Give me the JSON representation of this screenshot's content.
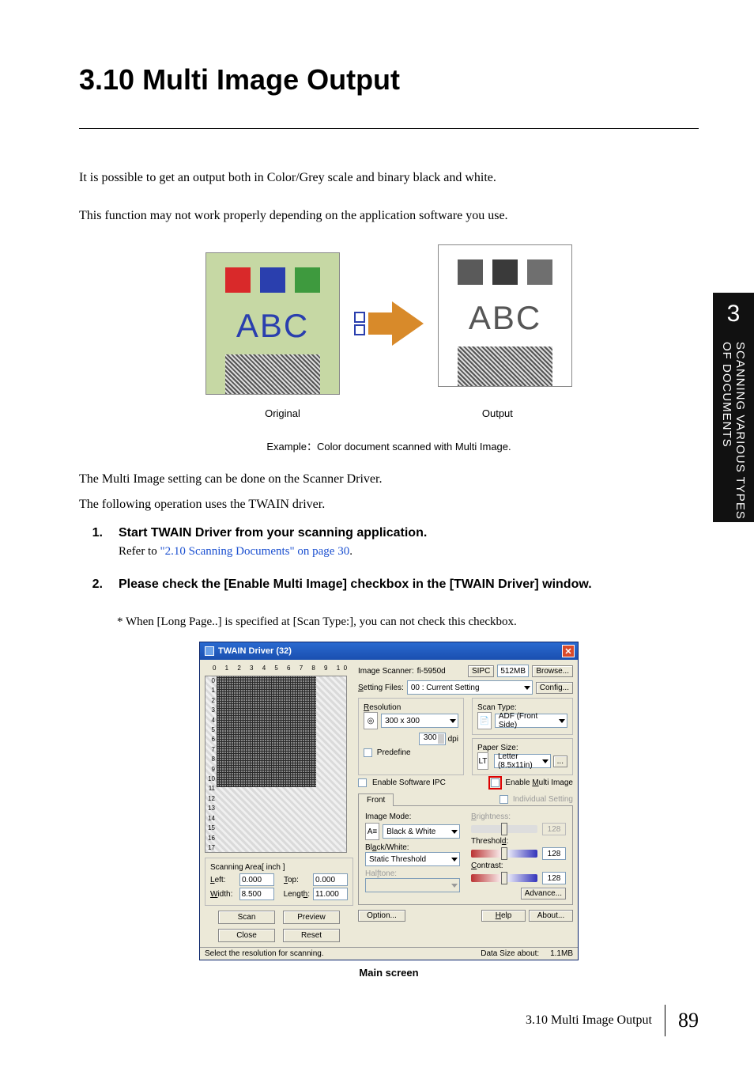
{
  "title": "3.10 Multi Image Output",
  "intro1": "It is possible to get an output  both in Color/Grey scale and binary black and white.",
  "intro2": "This function may not work properly depending on the application software you use.",
  "diagram": {
    "abc": "ABC",
    "original": "Original",
    "output": "Output"
  },
  "example_prefix": "Example",
  "example_colon": "：",
  "example_text": "Color document scanned with Multi Image.",
  "para1": "The Multi Image setting can be done on the Scanner Driver.",
  "para2": "The following operation uses the TWAIN driver.",
  "steps": {
    "s1": {
      "num": "1.",
      "title": "Start TWAIN Driver from your scanning application.",
      "refer": "Refer to ",
      "link": "\"2.10 Scanning Documents\" on page 30",
      "dot": "."
    },
    "s2": {
      "num": "2.",
      "title": "Please check the [Enable Multi Image] checkbox in the [TWAIN Driver] window.",
      "note": "* When [Long Page..] is specified at [Scan Type:], you can not check this checkbox."
    }
  },
  "dlg": {
    "title": "TWAIN Driver (32)",
    "ruler_h": "0   1   2   3   4   5   6   7   8   9  10  11",
    "ruler_v": [
      "0",
      "1",
      "2",
      "3",
      "4",
      "5",
      "6",
      "7",
      "8",
      "9",
      "10",
      "11",
      "12",
      "13",
      "14",
      "15",
      "16",
      "17"
    ],
    "scan_area_legend": "Scanning Area[ inch ]",
    "left_l": "Left:",
    "left_v": "0.000",
    "top_l": "Top:",
    "top_v": "0.000",
    "width_l": "Width:",
    "width_v": "8.500",
    "length_l": "Length:",
    "length_v": "11.000",
    "scan_btn": "Scan",
    "preview_btn": "Preview",
    "close_btn": "Close",
    "reset_btn": "Reset",
    "img_scanner_l": "Image Scanner:",
    "img_scanner_v": "fi-5950d",
    "sipc": "SIPC",
    "mem": "512MB",
    "browse": "Browse...",
    "setting_files_l": "Setting Files:",
    "setting_files_v": "00 : Current Setting",
    "config": "Config...",
    "resolution_legend": "Resolution",
    "resolution_v": "300 x 300",
    "dpi_v": "300",
    "dpi_u": "dpi",
    "predef": "Predefine",
    "scantype_legend": "Scan Type:",
    "scantype_v": "ADF (Front Side)",
    "papersize_legend": "Paper Size:",
    "papersize_v": "Letter (8.5x11in)",
    "en_soft_ipc": "Enable Software IPC",
    "en_multi": "Enable Multi Image",
    "front_tab": "Front",
    "individual": "Individual Setting",
    "image_mode_l": "Image Mode:",
    "image_mode_v": "Black & White",
    "bw_l": "Black/White:",
    "bw_v": "Static Threshold",
    "halftone_l": "Halftone:",
    "brightness_l": "Brightness:",
    "brightness_v": "128",
    "threshold_l": "Threshold:",
    "threshold_v": "128",
    "contrast_l": "Contrast:",
    "contrast_v": "128",
    "advance": "Advance...",
    "option": "Option...",
    "help": "Help",
    "about": "About...",
    "status_l": "Select the resolution for scanning.",
    "status_r1": "Data Size about:",
    "status_r2": "1.1MB"
  },
  "screenshot_caption": "Main screen",
  "side": {
    "num": "3",
    "text": "SCANNING VARIOUS TYPES OF DOCUMENTS"
  },
  "footer": {
    "label": "3.10 Multi Image Output",
    "page": "89"
  }
}
